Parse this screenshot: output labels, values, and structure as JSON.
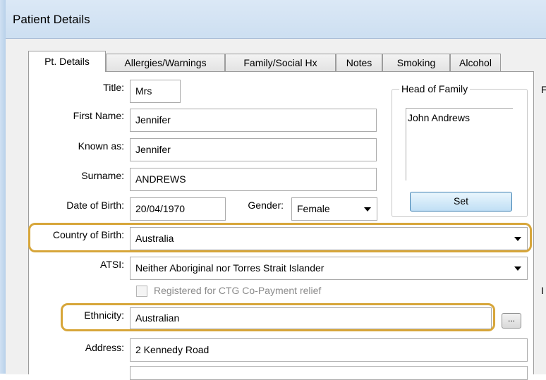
{
  "window": {
    "title": "Patient Details"
  },
  "tabs": [
    "Pt. Details",
    "Allergies/Warnings",
    "Family/Social Hx",
    "Notes",
    "Smoking",
    "Alcohol"
  ],
  "form": {
    "title_label": "Title:",
    "title_value": "Mrs",
    "first_name_label": "First Name:",
    "first_name_value": "Jennifer",
    "known_as_label": "Known as:",
    "known_as_value": "Jennifer",
    "surname_label": "Surname:",
    "surname_value": "ANDREWS",
    "dob_label": "Date of Birth:",
    "dob_value": "20/04/1970",
    "gender_label": "Gender:",
    "gender_value": "Female",
    "country_label": "Country of Birth:",
    "country_value": "Australia",
    "atsi_label": "ATSI:",
    "atsi_value": "Neither Aboriginal nor Torres Strait Islander",
    "ctg_label": "Registered for CTG Co-Payment relief",
    "ethnicity_label": "Ethnicity:",
    "ethnicity_value": "Australian",
    "ethnicity_button": "...",
    "address_label": "Address:",
    "address_value": "2 Kennedy Road"
  },
  "head_of_family": {
    "legend": "Head of Family",
    "items": [
      "John Andrews"
    ],
    "set_button": "Set"
  },
  "edge_chars": {
    "top": "F",
    "bottom": "I"
  },
  "colors": {
    "highlight": "#d7a63a"
  }
}
